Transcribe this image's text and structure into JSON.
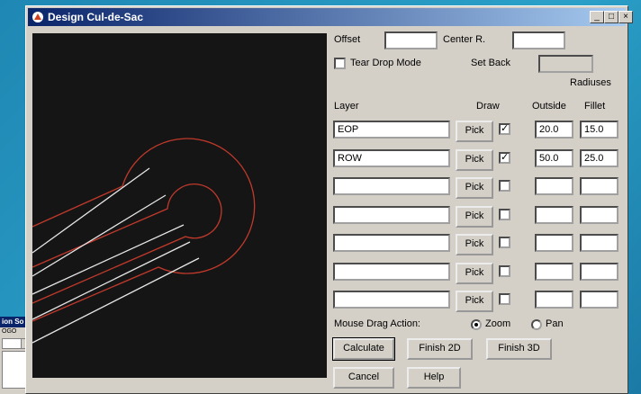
{
  "background_window": {
    "title": "ion So",
    "label": "OGO"
  },
  "window": {
    "title": "Design Cul-de-Sac",
    "controls": {
      "minimize": "_",
      "maximize": "□",
      "close": "×"
    }
  },
  "form": {
    "offset_label": "Offset",
    "offset_value": "",
    "center_r_label": "Center R.",
    "center_r_value": "",
    "tear_drop_label": "Tear Drop Mode",
    "tear_drop_checked": false,
    "set_back_label": "Set Back",
    "set_back_value": "",
    "radiuses_header": "Radiuses",
    "col_layer": "Layer",
    "col_draw": "Draw",
    "col_outside": "Outside",
    "col_fillet": "Fillet",
    "pick_label": "Pick",
    "rows": [
      {
        "layer": "EOP",
        "draw": true,
        "outside": "20.0",
        "fillet": "15.0",
        "check_glyph": "✓"
      },
      {
        "layer": "ROW",
        "draw": true,
        "outside": "50.0",
        "fillet": "25.0",
        "check_glyph": "✓"
      },
      {
        "layer": "",
        "draw": false,
        "outside": "",
        "fillet": "",
        "check_glyph": ""
      },
      {
        "layer": "",
        "draw": false,
        "outside": "",
        "fillet": "",
        "check_glyph": ""
      },
      {
        "layer": "",
        "draw": false,
        "outside": "",
        "fillet": "",
        "check_glyph": ""
      },
      {
        "layer": "",
        "draw": false,
        "outside": "",
        "fillet": "",
        "check_glyph": ""
      },
      {
        "layer": "",
        "draw": false,
        "outside": "",
        "fillet": "",
        "check_glyph": ""
      }
    ],
    "mouse_drag_label": "Mouse Drag Action:",
    "zoom_label": "Zoom",
    "pan_label": "Pan",
    "mouse_drag_selected": "Zoom"
  },
  "buttons": {
    "calculate": "Calculate",
    "finish_2d": "Finish 2D",
    "finish_3d": "Finish 3D",
    "cancel": "Cancel",
    "help": "Help"
  },
  "colors": {
    "canvas_bg": "#151515",
    "red_line": "#c0392b",
    "white_line": "#e6e6e6",
    "title_start": "#0a246a",
    "title_end": "#a6caf0"
  },
  "icons": {
    "app": "app-icon"
  }
}
